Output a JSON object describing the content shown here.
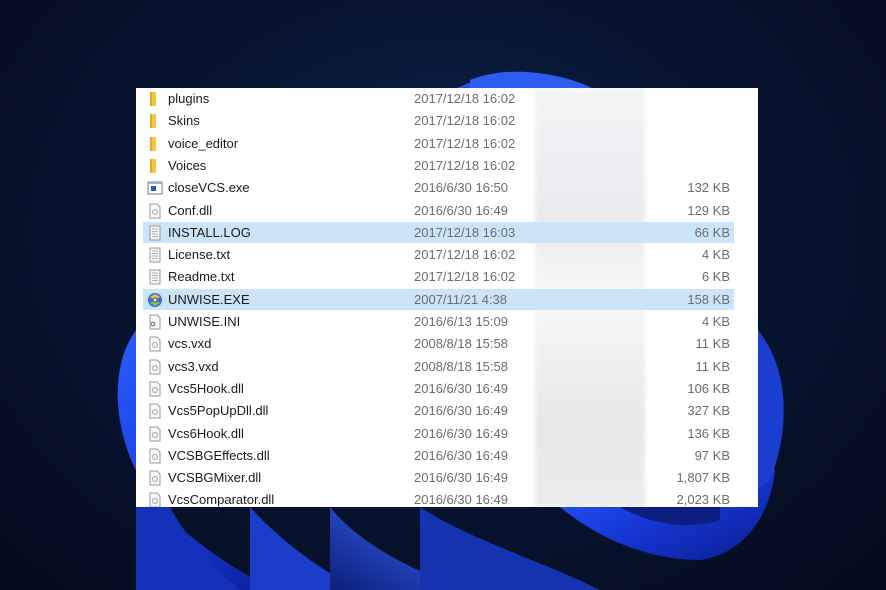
{
  "colors": {
    "selection": "#cce4f7",
    "folder": "#f5c542",
    "text_primary": "#1a1a1a",
    "text_secondary": "#6d6d6d"
  },
  "files": [
    {
      "name": "plugins",
      "date": "2017/12/18 16:02",
      "size": "",
      "icon": "folder-icon",
      "selected": false
    },
    {
      "name": "Skins",
      "date": "2017/12/18 16:02",
      "size": "",
      "icon": "folder-icon",
      "selected": false
    },
    {
      "name": "voice_editor",
      "date": "2017/12/18 16:02",
      "size": "",
      "icon": "folder-icon",
      "selected": false
    },
    {
      "name": "Voices",
      "date": "2017/12/18 16:02",
      "size": "",
      "icon": "folder-icon",
      "selected": false
    },
    {
      "name": "closeVCS.exe",
      "date": "2016/6/30 16:50",
      "size": "132 KB",
      "icon": "exe-icon",
      "selected": false
    },
    {
      "name": "Conf.dll",
      "date": "2016/6/30 16:49",
      "size": "129 KB",
      "icon": "dll-icon",
      "selected": false
    },
    {
      "name": "INSTALL.LOG",
      "date": "2017/12/18 16:03",
      "size": "66 KB",
      "icon": "text-file-icon",
      "selected": true
    },
    {
      "name": "License.txt",
      "date": "2017/12/18 16:02",
      "size": "4 KB",
      "icon": "text-file-icon",
      "selected": false
    },
    {
      "name": "Readme.txt",
      "date": "2017/12/18 16:02",
      "size": "6 KB",
      "icon": "text-file-icon",
      "selected": false
    },
    {
      "name": "UNWISE.EXE",
      "date": "2007/11/21 4:38",
      "size": "158 KB",
      "icon": "installer-icon",
      "selected": true
    },
    {
      "name": "UNWISE.INI",
      "date": "2016/6/13 15:09",
      "size": "4 KB",
      "icon": "ini-icon",
      "selected": false
    },
    {
      "name": "vcs.vxd",
      "date": "2008/8/18 15:58",
      "size": "11 KB",
      "icon": "dll-icon",
      "selected": false
    },
    {
      "name": "vcs3.vxd",
      "date": "2008/8/18 15:58",
      "size": "11 KB",
      "icon": "dll-icon",
      "selected": false
    },
    {
      "name": "Vcs5Hook.dll",
      "date": "2016/6/30 16:49",
      "size": "106 KB",
      "icon": "dll-icon",
      "selected": false
    },
    {
      "name": "Vcs5PopUpDll.dll",
      "date": "2016/6/30 16:49",
      "size": "327 KB",
      "icon": "dll-icon",
      "selected": false
    },
    {
      "name": "Vcs6Hook.dll",
      "date": "2016/6/30 16:49",
      "size": "136 KB",
      "icon": "dll-icon",
      "selected": false
    },
    {
      "name": "VCSBGEffects.dll",
      "date": "2016/6/30 16:49",
      "size": "97 KB",
      "icon": "dll-icon",
      "selected": false
    },
    {
      "name": "VCSBGMixer.dll",
      "date": "2016/6/30 16:49",
      "size": "1,807 KB",
      "icon": "dll-icon",
      "selected": false
    },
    {
      "name": "VcsComparator.dll",
      "date": "2016/6/30 16:49",
      "size": "2,023 KB",
      "icon": "dll-icon",
      "selected": false
    }
  ]
}
